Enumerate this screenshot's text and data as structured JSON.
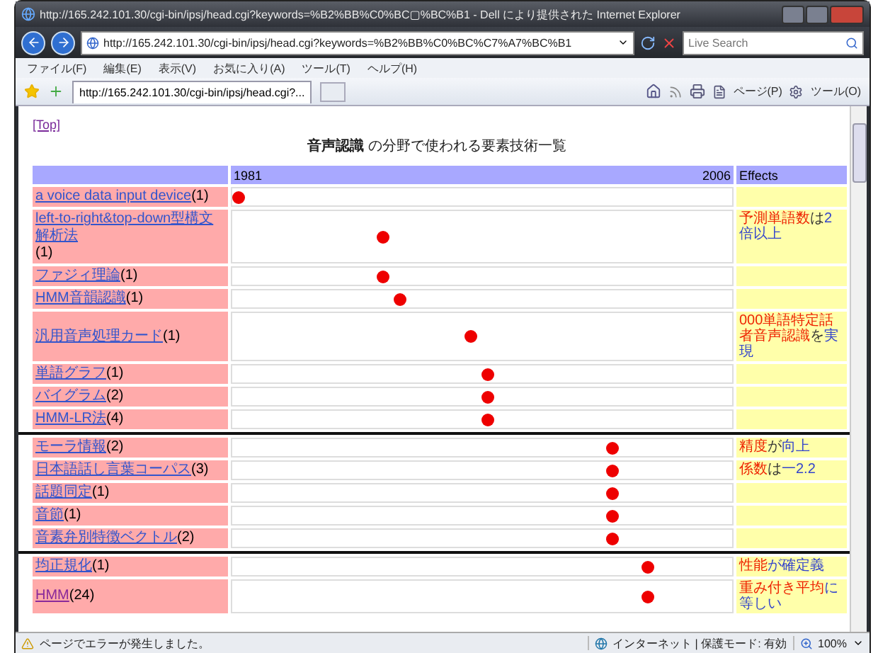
{
  "window": {
    "title": "http://165.242.101.30/cgi-bin/ipsj/head.cgi?keywords=%B2%BB%C0%BC▢%BC%B1 - Dell により提供された Internet Explorer"
  },
  "address": {
    "url": "http://165.242.101.30/cgi-bin/ipsj/head.cgi?keywords=%B2%BB%C0%BC%C7%A7%BC%B1"
  },
  "search": {
    "placeholder": "Live Search"
  },
  "menu": [
    "ファイル(F)",
    "編集(E)",
    "表示(V)",
    "お気に入り(A)",
    "ツール(T)",
    "ヘルプ(H)"
  ],
  "tab": {
    "title": "http://165.242.101.30/cgi-bin/ipsj/head.cgi?..."
  },
  "command_bar": [
    "ページ(P)",
    "ツール(O)"
  ],
  "page": {
    "top_link": "[Top]",
    "heading": "**音声認識** の分野で使われる要素技術一覧",
    "header": {
      "start": "1981",
      "end": "2006",
      "effects": "Effects"
    },
    "rows": [
      {
        "term": "a voice data input device ",
        "count": "(1)",
        "visited": false,
        "level": 0.01,
        "effects": []
      },
      {
        "term": "left-to-right&top-down型構文解析法",
        "count": "(1)",
        "visited": false,
        "level": 0.3,
        "effects": [
          {
            "text": "予測単語数",
            "kind": "term"
          },
          {
            "text": "は",
            "kind": "particle"
          },
          {
            "text": "2倍以上",
            "kind": "other"
          }
        ]
      },
      {
        "term": "ファジィ理論",
        "count": "(1)",
        "visited": false,
        "level": 0.3,
        "effects": []
      },
      {
        "term": "HMM音韻認識",
        "count": "(1)",
        "visited": false,
        "level": 0.335,
        "effects": []
      },
      {
        "term": "汎用音声処理カード",
        "count": "(1)",
        "visited": false,
        "level": 0.475,
        "effects": [
          {
            "text": "000単語特定話者音声認識",
            "kind": "term"
          },
          {
            "text": "を",
            "kind": "particle"
          },
          {
            "text": "実現",
            "kind": "other"
          }
        ]
      },
      {
        "term": "単語グラフ",
        "count": "(1)",
        "visited": false,
        "level": 0.51,
        "effects": []
      },
      {
        "term": "バイグラム",
        "count": "(2)",
        "visited": false,
        "level": 0.51,
        "effects": []
      },
      {
        "term": "HMM-LR法",
        "count": "(4)",
        "visited": false,
        "level": 0.51,
        "effects": []
      },
      {
        "term": "モーラ情報",
        "count": "(2)",
        "visited": false,
        "level": 0.76,
        "effects": [
          {
            "text": "精度",
            "kind": "term"
          },
          {
            "text": "が",
            "kind": "particle"
          },
          {
            "text": "向上",
            "kind": "other"
          }
        ]
      },
      {
        "term": "日本語話し言葉コーパス",
        "count": "(3)",
        "visited": false,
        "level": 0.76,
        "effects": [
          {
            "text": "係数",
            "kind": "term"
          },
          {
            "text": "は",
            "kind": "particle"
          },
          {
            "text": "一2.2",
            "kind": "other"
          }
        ]
      },
      {
        "term": "話題同定",
        "count": "(1)",
        "visited": false,
        "level": 0.76,
        "effects": []
      },
      {
        "term": "音節",
        "count": "(1)",
        "visited": false,
        "level": 0.76,
        "effects": []
      },
      {
        "term": "音素弁別特徴ベクトル",
        "count": "(2)",
        "visited": false,
        "level": 0.76,
        "effects": []
      },
      {
        "term": "均正規化",
        "count": "(1)",
        "visited": false,
        "level": 0.83,
        "effects": [
          {
            "text": "性能",
            "kind": "term"
          },
          {
            "text": "が確",
            "kind": "other"
          },
          {
            "text": "定義",
            "kind": "other"
          }
        ]
      },
      {
        "term": "HMM",
        "count": "(24)",
        "visited": true,
        "level": 0.83,
        "effects": [
          {
            "text": "重み付き平均",
            "kind": "term"
          },
          {
            "text": "に等しい",
            "kind": "other"
          }
        ]
      }
    ]
  },
  "status_bar": {
    "message": "ページでエラーが発生しました。",
    "zone": "インターネット | 保護モード: 有効",
    "zoom": "100%"
  }
}
